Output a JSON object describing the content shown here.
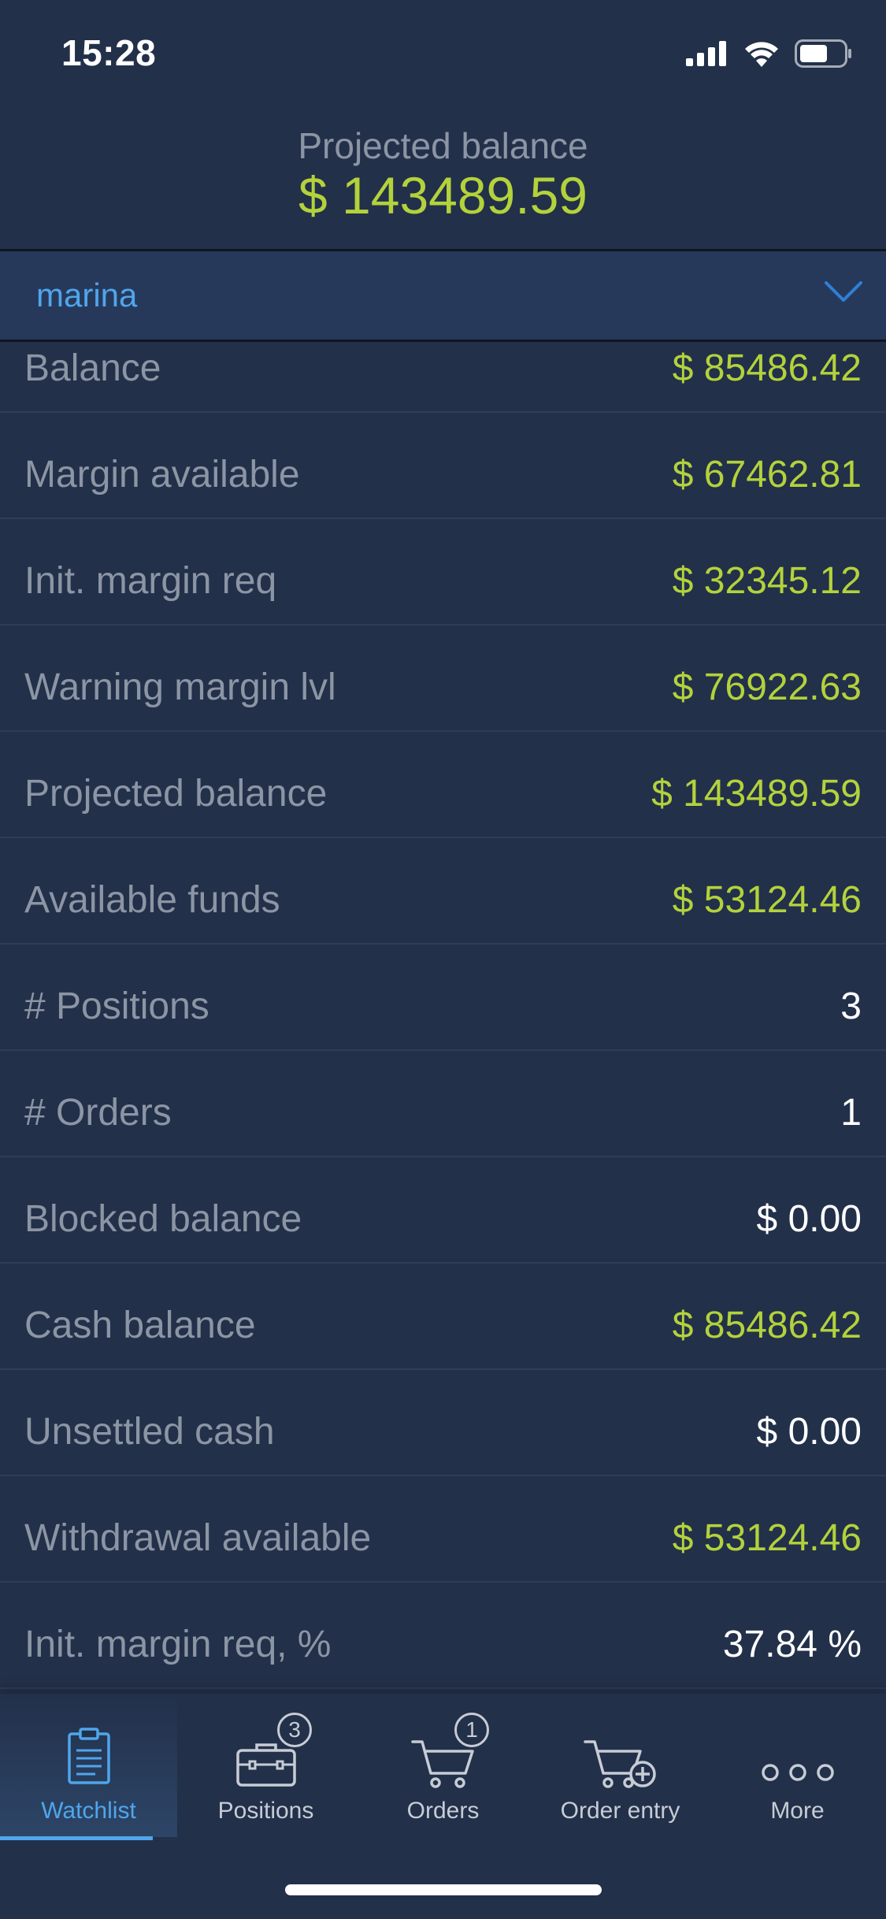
{
  "status_bar": {
    "time": "15:28",
    "icons": [
      "signal-icon",
      "wifi-icon",
      "battery-icon"
    ]
  },
  "header": {
    "label": "Projected balance",
    "value": "$ 143489.59"
  },
  "account": {
    "name": "marina"
  },
  "rows": [
    {
      "label": "Balance",
      "value": "$ 85486.42",
      "tone": "green"
    },
    {
      "label": "Margin available",
      "value": "$ 67462.81",
      "tone": "green"
    },
    {
      "label": "Init. margin req",
      "value": "$ 32345.12",
      "tone": "green"
    },
    {
      "label": "Warning margin lvl",
      "value": "$ 76922.63",
      "tone": "green"
    },
    {
      "label": "Projected balance",
      "value": "$ 143489.59",
      "tone": "green"
    },
    {
      "label": "Available funds",
      "value": "$ 53124.46",
      "tone": "green"
    },
    {
      "label": "# Positions",
      "value": "3",
      "tone": "white"
    },
    {
      "label": "# Orders",
      "value": "1",
      "tone": "white"
    },
    {
      "label": "Blocked balance",
      "value": "$ 0.00",
      "tone": "white"
    },
    {
      "label": "Cash balance",
      "value": "$ 85486.42",
      "tone": "green"
    },
    {
      "label": "Unsettled cash",
      "value": "$ 0.00",
      "tone": "white"
    },
    {
      "label": "Withdrawal available",
      "value": "$ 53124.46",
      "tone": "green"
    },
    {
      "label": "Init. margin req, %",
      "value": "37.84 %",
      "tone": "white"
    }
  ],
  "tabs": [
    {
      "label": "Watchlist",
      "icon": "clipboard-icon",
      "active": true
    },
    {
      "label": "Positions",
      "icon": "briefcase-icon",
      "badge": "3"
    },
    {
      "label": "Orders",
      "icon": "cart-icon",
      "badge": "1"
    },
    {
      "label": "Order entry",
      "icon": "cart-plus-icon"
    },
    {
      "label": "More",
      "icon": "more-dots-icon"
    }
  ],
  "colors": {
    "background": "#22304a",
    "accent_blue": "#4fa6ec",
    "value_green": "#b3d23b",
    "label_gray": "#8c95a4"
  }
}
